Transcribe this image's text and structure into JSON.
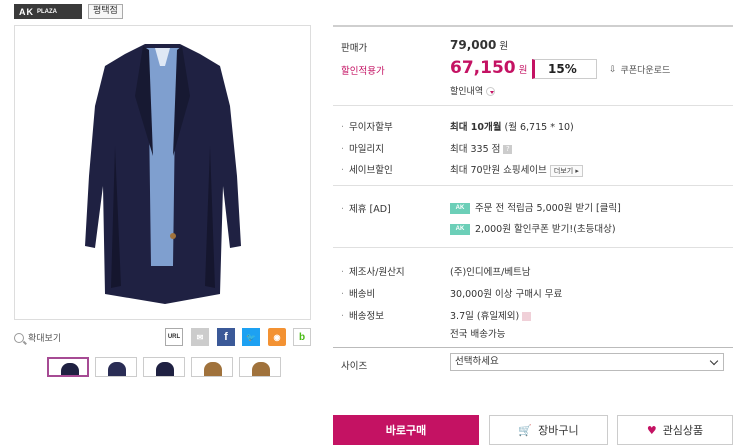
{
  "header": {
    "brand": "AK",
    "brand_sub": "PLAZA",
    "store": "평택점"
  },
  "gallery": {
    "zoom_label": "확대보기",
    "share": [
      "URL",
      "mail",
      "f",
      "twitter",
      "kakaostory",
      "band"
    ]
  },
  "price": {
    "list_label": "판매가",
    "list_price": "79,000",
    "won": "원",
    "sale_label": "할인적용가",
    "sale_price": "67,150",
    "discount": "15%",
    "coupon_download": "쿠폰다운로드",
    "discount_details": "할인내역"
  },
  "benefits": {
    "installment_label": "무이자할부",
    "installment_bold": "최대 10개월",
    "installment_rest": " (월 6,715 * 10)",
    "mileage_label": "마일리지",
    "mileage_value": "최대 335 점",
    "save_label": "세이브할인",
    "save_value": "최대 70만원 쇼핑세이브",
    "save_more": "더보기"
  },
  "partner": {
    "label": "제휴 [AD]",
    "badge": "AK",
    "offer1": "주문 전 적립금 5,000원 받기 [클릭]",
    "offer2": "2,000원 할인쿠폰 받기!(초등대상)"
  },
  "info": {
    "maker_label": "제조사/원산지",
    "maker_value": "(주)인디에프/베트남",
    "shipping_fee_label": "배송비",
    "shipping_fee_value": "30,000원 이상 구매시 무료",
    "shipping_info_label": "배송정보",
    "shipping_info_value": "3.7일 (휴일제외)",
    "shipping_area": "전국 배송가능"
  },
  "option": {
    "size_label": "사이즈",
    "size_placeholder": "선택하세요"
  },
  "actions": {
    "buy": "바로구매",
    "cart": "장바구니",
    "wish": "관심상품"
  },
  "colors": {
    "accent": "#c41263",
    "coat": "#1f2142",
    "thumb_brown": "#a0723c"
  }
}
